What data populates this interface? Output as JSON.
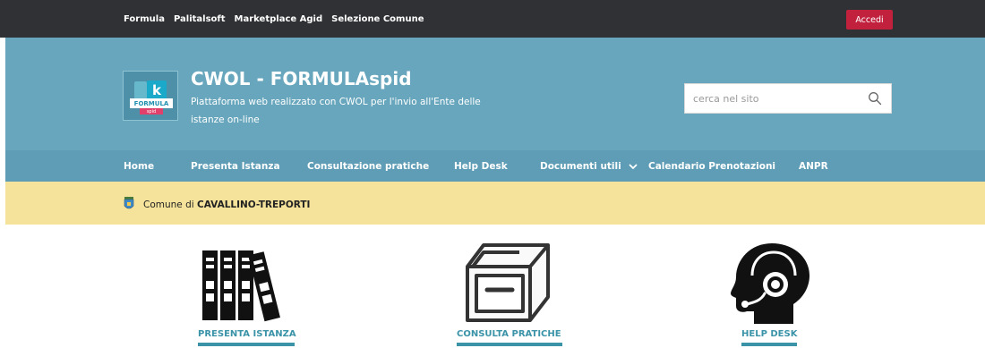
{
  "topbar": {
    "links": [
      "Formula",
      "Palitalsoft",
      "Marketplace Agid",
      "Selezione Comune"
    ],
    "login_label": "Accedi"
  },
  "header": {
    "logo": {
      "k": "k",
      "band": "FORMULA",
      "spid": "spid"
    },
    "title": "CWOL - FORMULAspid",
    "description": "Piattaforma web realizzato con CWOL per l'invio all'Ente delle istanze on-line",
    "search_placeholder": "cerca nel sito"
  },
  "nav": {
    "items": [
      "Home",
      "Presenta Istanza",
      "Consultazione pratiche",
      "Help Desk",
      "Documenti utili",
      "Calendario Prenotazioni",
      "ANPR"
    ]
  },
  "comune": {
    "prefix": "Comune di",
    "name": "CAVALLINO-TREPORTI"
  },
  "cards": [
    {
      "label": "PRESENTA ISTANZA",
      "icon": "binders-icon"
    },
    {
      "label": "CONSULTA PRATICHE",
      "icon": "archive-box-icon"
    },
    {
      "label": "HELP DESK",
      "icon": "headset-icon"
    }
  ],
  "colors": {
    "topbar": "#2f3134",
    "header": "#67a6bc",
    "nav": "#5e9db5",
    "comune_bar": "#f6e39b",
    "login_button": "#c2213e",
    "accent": "#3b93a8"
  }
}
